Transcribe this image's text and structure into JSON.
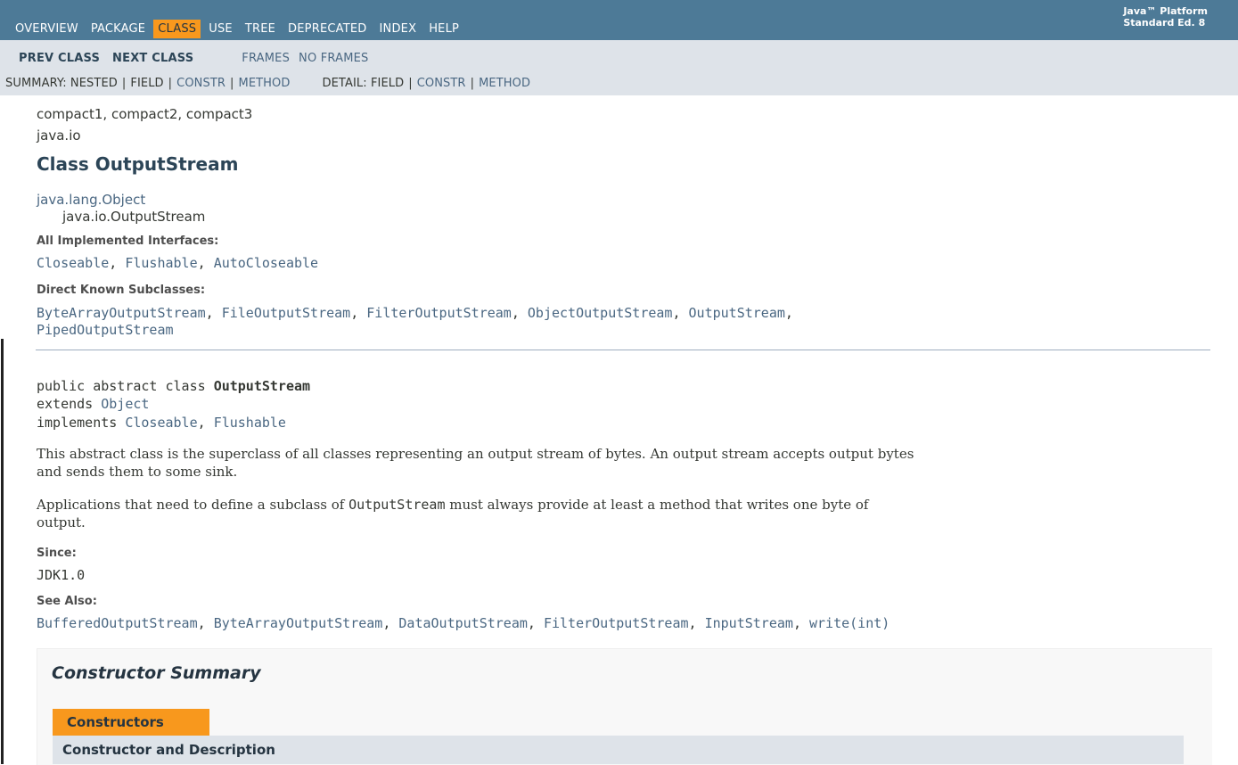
{
  "topnav": {
    "items": [
      "OVERVIEW",
      "PACKAGE",
      "CLASS",
      "USE",
      "TREE",
      "DEPRECATED",
      "INDEX",
      "HELP"
    ],
    "active": "CLASS",
    "about_line1": "Java™ Platform",
    "about_line2": "Standard Ed. 8"
  },
  "subnav": {
    "prev_class": "PREV CLASS",
    "next_class": "NEXT CLASS",
    "frames": "FRAMES",
    "no_frames": "NO FRAMES",
    "summary_label": "SUMMARY: NESTED",
    "summary_field": "FIELD",
    "summary_constr": "CONSTR",
    "summary_method": "METHOD",
    "detail_label": "DETAIL: FIELD",
    "detail_constr": "CONSTR",
    "detail_method": "METHOD",
    "separator": "|"
  },
  "header": {
    "profiles": "compact1, compact2, compact3",
    "package": "java.io",
    "title": "Class OutputStream"
  },
  "inheritance": {
    "root": "java.lang.Object",
    "child": "java.io.OutputStream"
  },
  "interfaces": {
    "label": "All Implemented Interfaces:",
    "items": [
      "Closeable",
      "Flushable",
      "AutoCloseable"
    ]
  },
  "subclasses": {
    "label": "Direct Known Subclasses:",
    "items": [
      "ByteArrayOutputStream",
      "FileOutputStream",
      "FilterOutputStream",
      "ObjectOutputStream",
      "OutputStream",
      "PipedOutputStream"
    ]
  },
  "signature": {
    "prefix": "public abstract class ",
    "name": "OutputStream",
    "extends_kw": "extends ",
    "extends_type": "Object",
    "implements_kw": "implements ",
    "implements_types": [
      "Closeable",
      "Flushable"
    ]
  },
  "description": {
    "para1_line1": "This abstract class is the superclass of all classes representing an output stream of bytes. An output stream accepts output bytes",
    "para1_line2": "and sends them to some sink.",
    "para2_part1": "Applications that need to define a subclass of ",
    "para2_code": "OutputStream",
    "para2_part2": " must always provide at least a method that writes one byte of",
    "para2_line2": "output."
  },
  "since": {
    "label": "Since:",
    "value": "JDK1.0"
  },
  "see_also": {
    "label": "See Also:",
    "items": [
      "BufferedOutputStream",
      "ByteArrayOutputStream",
      "DataOutputStream",
      "FilterOutputStream",
      "InputStream",
      "write(int)"
    ]
  },
  "constructor_summary": {
    "title": "Constructor Summary",
    "tab": "Constructors",
    "column_header": "Constructor and Description"
  },
  "colors": {
    "nav_bg": "#4D7A97",
    "subnav_bg": "#DEE3E9",
    "accent": "#F8981D",
    "link": "#4A6782"
  }
}
